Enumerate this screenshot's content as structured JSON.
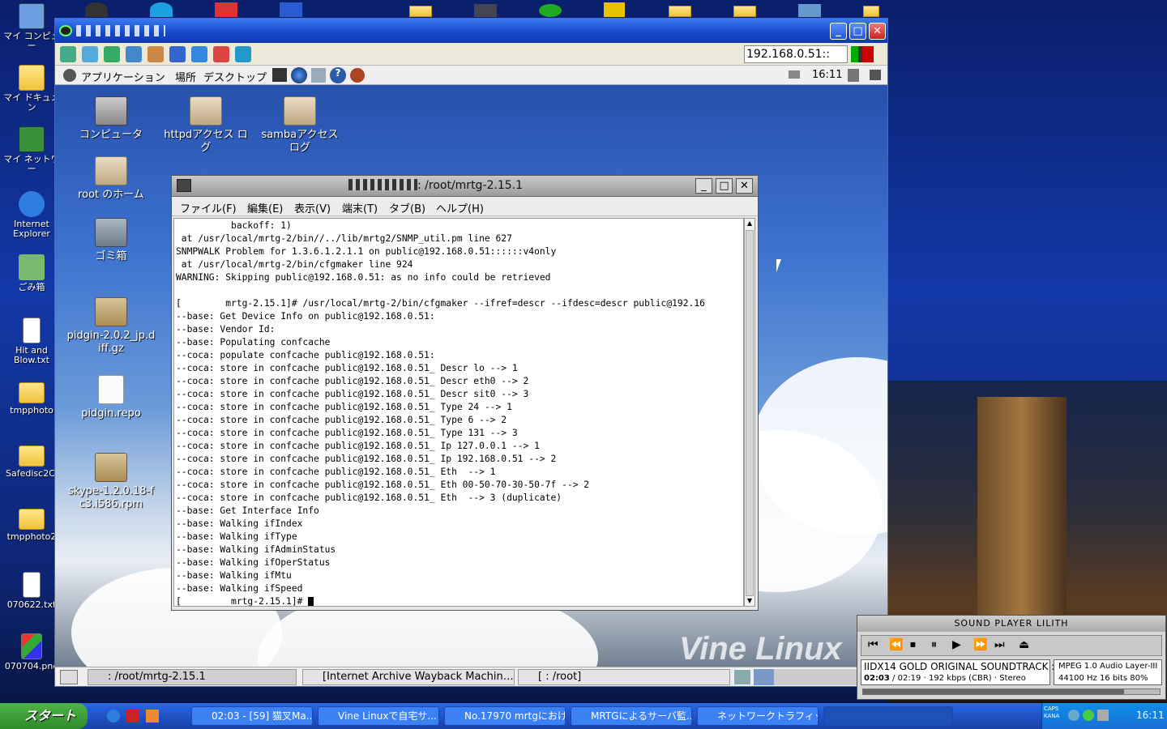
{
  "host_desktop": {
    "icons": [
      {
        "label": "マイ コンピュー",
        "icon": "my-computer-icon"
      },
      {
        "label": "マイ ドキュメン",
        "icon": "my-documents-icon"
      },
      {
        "label": "マイ ネットワー",
        "icon": "my-network-icon"
      },
      {
        "label": "Internet Explorer",
        "icon": "internet-explorer-icon"
      },
      {
        "label": "ごみ箱",
        "icon": "recycle-bin-icon"
      },
      {
        "label": "Hit and Blow.txt",
        "icon": "text-file-icon"
      },
      {
        "label": "tmpphoto",
        "icon": "folder-icon"
      },
      {
        "label": "Safedisc2Cl",
        "icon": "folder-icon"
      },
      {
        "label": "tmpphoto2",
        "icon": "folder-icon"
      },
      {
        "label": "070622.txt",
        "icon": "text-file-icon"
      },
      {
        "label": "070704.pne",
        "icon": "image-file-icon"
      }
    ]
  },
  "vnc": {
    "title": "",
    "address": "192.168.0.51::",
    "remote_panel": {
      "menus": [
        "アプリケーション",
        "場所",
        "デスクトップ"
      ],
      "clock": "16:11"
    },
    "remote_icons": [
      {
        "label": "コンピュータ",
        "icon": "computer-icon"
      },
      {
        "label": "httpdアクセス ログ",
        "icon": "folder-link-icon"
      },
      {
        "label": "sambaアクセス ログ",
        "icon": "folder-link-icon"
      },
      {
        "label": "root のホーム",
        "icon": "home-folder-icon"
      },
      {
        "label": "ゴミ箱",
        "icon": "trash-icon"
      },
      {
        "label": "pidgin-2.0.2_jp.diff.gz",
        "icon": "gz-archive-icon"
      },
      {
        "label": "pidgin.repo",
        "icon": "blank-file-icon"
      },
      {
        "label": "skype-1.2.0.18-fc3.i586.rpm",
        "icon": "rpm-package-icon"
      }
    ],
    "watermark": "Vine Linux",
    "terminal": {
      "title": ": /root/mrtg-2.15.1",
      "menu": [
        "ファイル(F)",
        "編集(E)",
        "表示(V)",
        "端末(T)",
        "タブ(B)",
        "ヘルプ(H)"
      ],
      "lines": [
        "          backoff: 1)",
        " at /usr/local/mrtg-2/bin//../lib/mrtg2/SNMP_util.pm line 627",
        "SNMPWALK Problem for 1.3.6.1.2.1.1 on public@192.168.0.51::::::v4only",
        " at /usr/local/mrtg-2/bin/cfgmaker line 924",
        "WARNING: Skipping public@192.168.0.51: as no info could be retrieved",
        "",
        "[        mrtg-2.15.1]# /usr/local/mrtg-2/bin/cfgmaker --ifref=descr --ifdesc=descr public@192.16",
        "--base: Get Device Info on public@192.168.0.51:",
        "--base: Vendor Id:",
        "--base: Populating confcache",
        "--coca: populate confcache public@192.168.0.51:",
        "--coca: store in confcache public@192.168.0.51_ Descr lo --> 1",
        "--coca: store in confcache public@192.168.0.51_ Descr eth0 --> 2",
        "--coca: store in confcache public@192.168.0.51_ Descr sit0 --> 3",
        "--coca: store in confcache public@192.168.0.51_ Type 24 --> 1",
        "--coca: store in confcache public@192.168.0.51_ Type 6 --> 2",
        "--coca: store in confcache public@192.168.0.51_ Type 131 --> 3",
        "--coca: store in confcache public@192.168.0.51_ Ip 127.0.0.1 --> 1",
        "--coca: store in confcache public@192.168.0.51_ Ip 192.168.0.51 --> 2",
        "--coca: store in confcache public@192.168.0.51_ Eth  --> 1",
        "--coca: store in confcache public@192.168.0.51_ Eth 00-50-70-30-50-7f --> 2",
        "--coca: store in confcache public@192.168.0.51_ Eth  --> 3 (duplicate)",
        "--base: Get Interface Info",
        "--base: Walking ifIndex",
        "--base: Walking ifType",
        "--base: Walking ifAdminStatus",
        "--base: Walking ifOperStatus",
        "--base: Walking ifMtu",
        "--base: Walking ifSpeed",
        "[         mrtg-2.15.1]# "
      ]
    },
    "bottom_tasks": [
      ": /root/mrtg-2.15.1",
      "[Internet Archive Wayback Machin…",
      "[           : /root]"
    ]
  },
  "lilith": {
    "title": "SOUND PLAYER LILITH",
    "track": "IIDX14 GOLD ORIGINAL SOUNDTRACK :",
    "format": "MPEG 1.0 Audio Layer-III",
    "time": "02:03",
    "total": "02:19",
    "bitrate": "192 kbps (CBR)",
    "mode": "Stereo",
    "sample": "44100 Hz 16 bits",
    "volume": "80%",
    "progress": 0.88
  },
  "taskbar": {
    "start": "スタート",
    "tasks": [
      "02:03 - [59] 猫叉Ma...",
      "Vine Linuxで自宅サ...",
      "No.17970 mrtgにおけ...",
      "MRTGによるサーバ監...",
      "ネットワークトラフィック..."
    ],
    "clock": "16:11",
    "caps": "CAPS",
    "kana": "KANA"
  }
}
